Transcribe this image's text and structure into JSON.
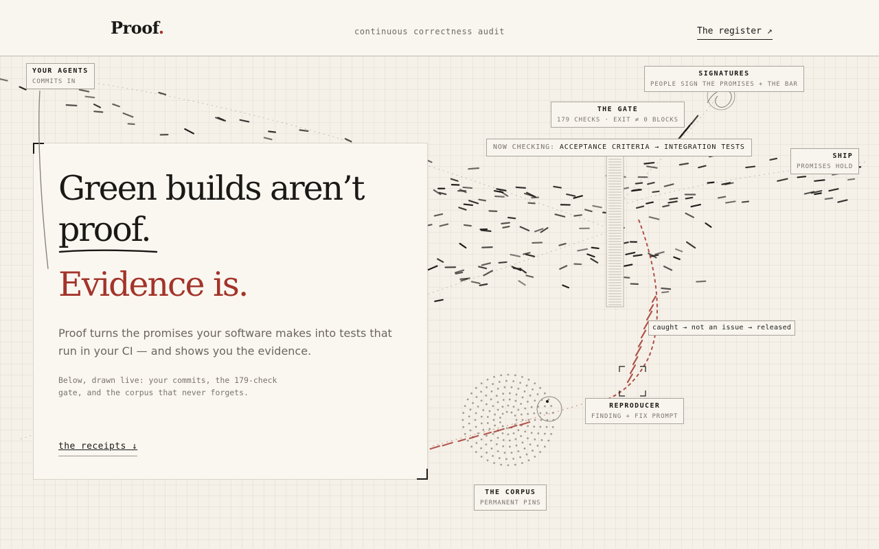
{
  "header": {
    "logo_text": "Proof",
    "logo_dot": ".",
    "tagline": "continuous correctness audit",
    "register_link": "The register ↗"
  },
  "colors": {
    "accent": "#a3342a",
    "ink": "#1b1916",
    "paper": "#f5f1e9",
    "muted": "#6b665f"
  },
  "diagram": {
    "agents": {
      "title": "YOUR AGENTS",
      "subtitle": "COMMITS IN"
    },
    "signatures": {
      "title": "SIGNATURES",
      "subtitle": "PEOPLE SIGN THE PROMISES + THE BAR"
    },
    "gate": {
      "title": "THE GATE",
      "subtitle": "179 CHECKS · EXIT ≠ 0 BLOCKS"
    },
    "now_checking": {
      "label": "NOW CHECKING:",
      "value": "ACCEPTANCE CRITERIA → INTEGRATION TESTS"
    },
    "ship": {
      "title": "SHIP",
      "subtitle": "PROMISES HOLD"
    },
    "caught": {
      "text": "caught → not an issue → released"
    },
    "reproducer": {
      "title": "REPRODUCER",
      "subtitle": "FINDING + FIX PROMPT"
    },
    "corpus": {
      "title": "THE CORPUS",
      "subtitle": "PERMANENT PINS"
    }
  },
  "hero": {
    "line1": "Green builds aren’t",
    "line2": "proof.",
    "line3": "Evidence is.",
    "lead": "Proof turns the promises your software makes into tests that run in your CI — and shows you the evidence.",
    "note": "Below, drawn live: your commits, the 179-check gate, and the corpus that never forgets.",
    "cta": "the receipts ↓"
  }
}
